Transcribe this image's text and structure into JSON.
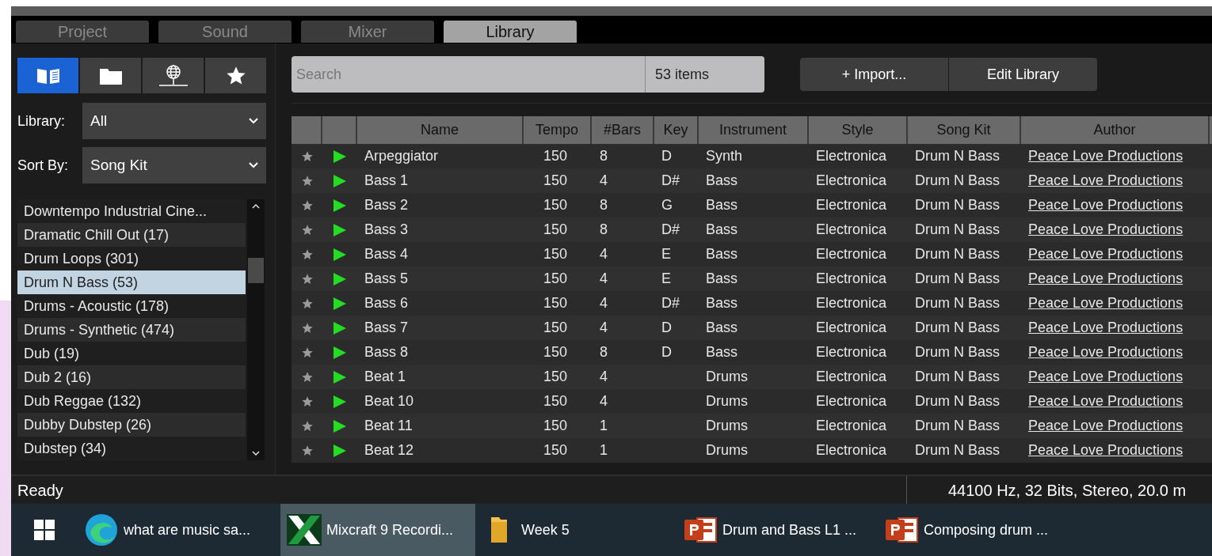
{
  "tabs": [
    {
      "label": "Project",
      "selected": false
    },
    {
      "label": "Sound",
      "selected": false
    },
    {
      "label": "Mixer",
      "selected": false
    },
    {
      "label": "Library",
      "selected": true
    }
  ],
  "sidebar": {
    "view_buttons": [
      {
        "kind": "book",
        "selected": true
      },
      {
        "kind": "folder",
        "selected": false
      },
      {
        "kind": "globe",
        "selected": false
      },
      {
        "kind": "star",
        "selected": false
      }
    ],
    "library": {
      "label": "Library:",
      "value": "All"
    },
    "sort_by": {
      "label": "Sort By:",
      "value": "Song Kit"
    },
    "items": [
      {
        "label": "Downtempo Industrial Cine...",
        "selected": false
      },
      {
        "label": "Dramatic Chill Out (17)",
        "selected": false
      },
      {
        "label": "Drum Loops (301)",
        "selected": false
      },
      {
        "label": "Drum N Bass (53)",
        "selected": true
      },
      {
        "label": "Drums - Acoustic (178)",
        "selected": false
      },
      {
        "label": "Drums - Synthetic (474)",
        "selected": false
      },
      {
        "label": "Dub (19)",
        "selected": false
      },
      {
        "label": "Dub 2 (16)",
        "selected": false
      },
      {
        "label": "Dub Reggae (132)",
        "selected": false
      },
      {
        "label": "Dubby Dubstep (26)",
        "selected": false
      },
      {
        "label": "Dubstep (34)",
        "selected": false
      }
    ]
  },
  "toolbar": {
    "search": {
      "placeholder": "Search"
    },
    "count": "53 items",
    "buttons": [
      "+ Import...",
      "Edit Library"
    ]
  },
  "table": {
    "columns": [
      "Name",
      "Tempo",
      "#Bars",
      "Key",
      "Instrument",
      "Style",
      "Song Kit",
      "Author"
    ],
    "rows": [
      [
        "Arpeggiator",
        "150",
        "8",
        "D",
        "Synth",
        "Electronica",
        "Drum N Bass",
        "Peace Love Productions"
      ],
      [
        "Bass 1",
        "150",
        "4",
        "D#",
        "Bass",
        "Electronica",
        "Drum N Bass",
        "Peace Love Productions"
      ],
      [
        "Bass 2",
        "150",
        "8",
        "G",
        "Bass",
        "Electronica",
        "Drum N Bass",
        "Peace Love Productions"
      ],
      [
        "Bass 3",
        "150",
        "8",
        "D#",
        "Bass",
        "Electronica",
        "Drum N Bass",
        "Peace Love Productions"
      ],
      [
        "Bass 4",
        "150",
        "4",
        "E",
        "Bass",
        "Electronica",
        "Drum N Bass",
        "Peace Love Productions"
      ],
      [
        "Bass 5",
        "150",
        "4",
        "E",
        "Bass",
        "Electronica",
        "Drum N Bass",
        "Peace Love Productions"
      ],
      [
        "Bass 6",
        "150",
        "4",
        "D#",
        "Bass",
        "Electronica",
        "Drum N Bass",
        "Peace Love Productions"
      ],
      [
        "Bass 7",
        "150",
        "4",
        "D",
        "Bass",
        "Electronica",
        "Drum N Bass",
        "Peace Love Productions"
      ],
      [
        "Bass 8",
        "150",
        "8",
        "D",
        "Bass",
        "Electronica",
        "Drum N Bass",
        "Peace Love Productions"
      ],
      [
        "Beat 1",
        "150",
        "4",
        null,
        "Drums",
        "Electronica",
        "Drum N Bass",
        "Peace Love Productions"
      ],
      [
        "Beat 10",
        "150",
        "4",
        null,
        "Drums",
        "Electronica",
        "Drum N Bass",
        "Peace Love Productions"
      ],
      [
        "Beat 11",
        "150",
        "1",
        null,
        "Drums",
        "Electronica",
        "Drum N Bass",
        "Peace Love Productions"
      ],
      [
        "Beat 12",
        "150",
        "1",
        null,
        "Drums",
        "Electronica",
        "Drum N Bass",
        "Peace Love Productions"
      ]
    ]
  },
  "status_bar": {
    "left": "Ready",
    "right": "44100 Hz, 32 Bits, Stereo, 20.0 m"
  },
  "taskbar": {
    "items": [
      {
        "kind": "browser",
        "label": "what are music sa...",
        "selected": false
      },
      {
        "kind": "mixcraft",
        "label": "Mixcraft 9 Recordi...",
        "selected": true
      },
      {
        "kind": "folder",
        "label": "Week 5",
        "selected": false
      },
      {
        "kind": "presentation",
        "label": "Drum and Bass L1 ...",
        "selected": false
      },
      {
        "kind": "presentation",
        "label": "Composing drum ...",
        "selected": false
      }
    ]
  }
}
